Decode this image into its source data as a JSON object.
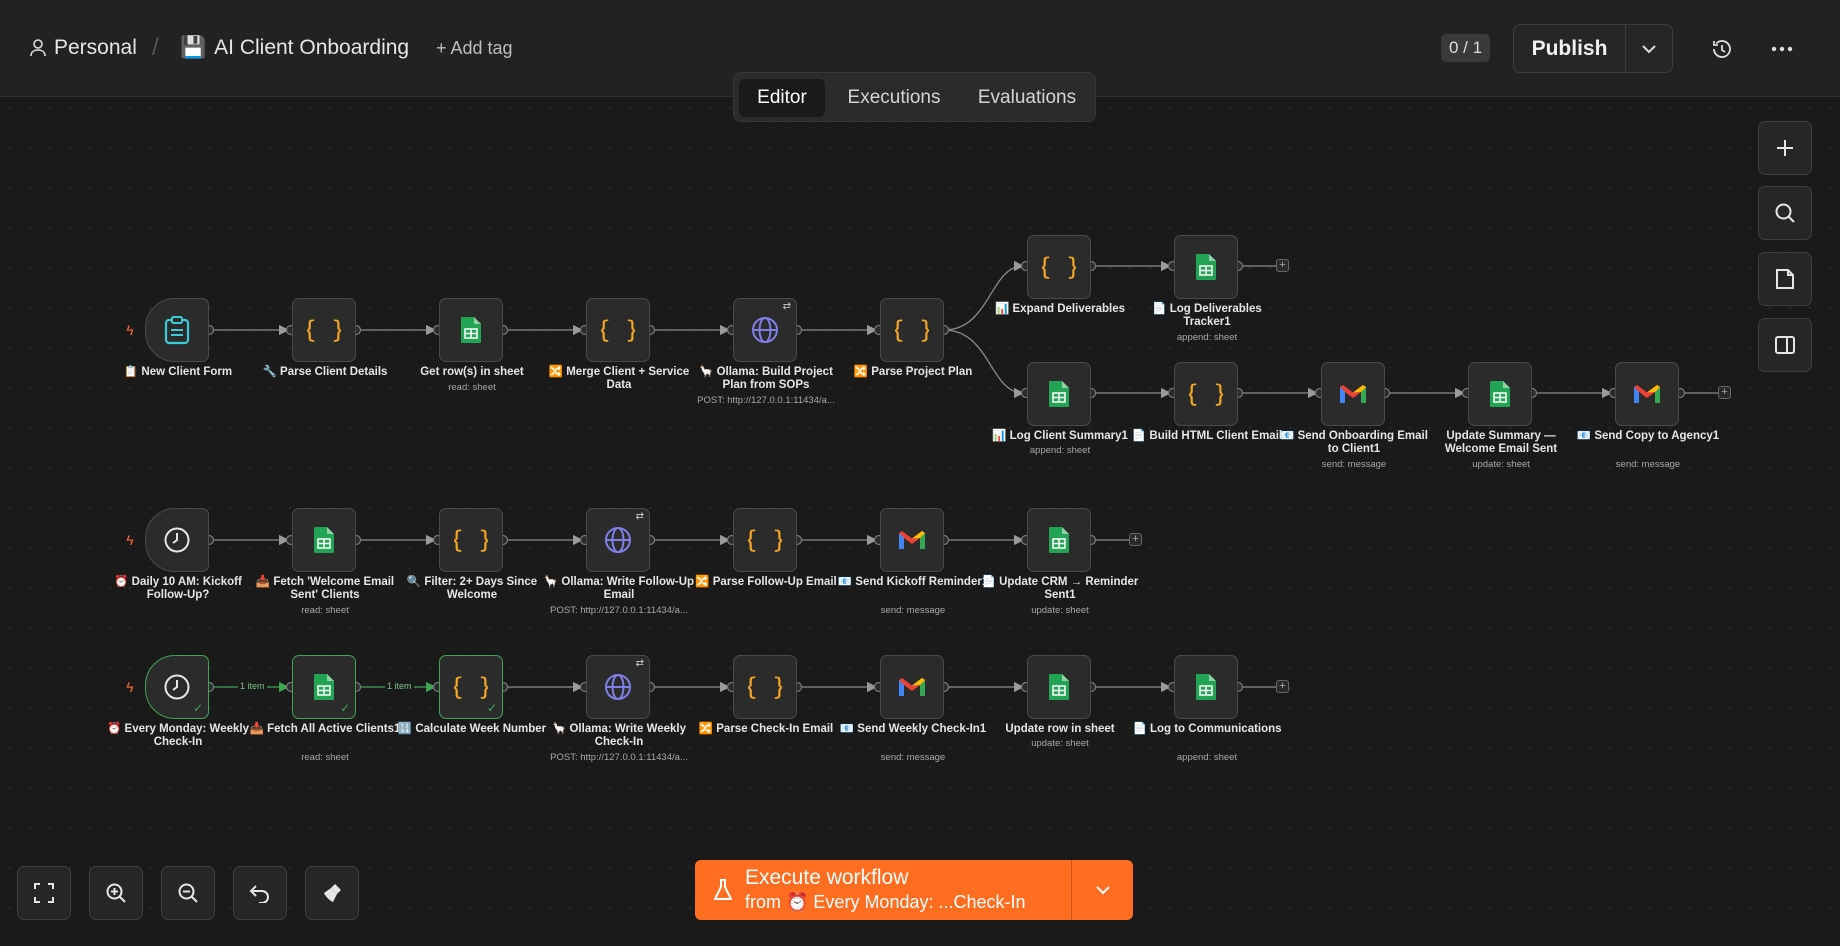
{
  "header": {
    "project": "Personal",
    "workflow_icon": "💾",
    "workflow_name": "AI Client Onboarding",
    "add_tag": "+ Add tag",
    "counter": "0 / 1",
    "publish": "Publish"
  },
  "tabs": [
    "Editor",
    "Executions",
    "Evaluations"
  ],
  "active_tab": "Editor",
  "nodes": {
    "n1": {
      "label": "📋 New Client Form",
      "sub": ""
    },
    "n2": {
      "label": "🔧 Parse Client Details",
      "sub": ""
    },
    "n3": {
      "label": "Get row(s) in sheet",
      "sub": "read: sheet"
    },
    "n4": {
      "label": "🔀 Merge Client + Service Data",
      "sub": ""
    },
    "n5": {
      "label": "🦙 Ollama: Build Project Plan from SOPs",
      "sub": "POST: http://127.0.0.1:11434/a..."
    },
    "n6": {
      "label": "🔀 Parse Project Plan",
      "sub": ""
    },
    "n7": {
      "label": "📊 Expand Deliverables",
      "sub": ""
    },
    "n8": {
      "label": "📄 Log Deliverables Tracker1",
      "sub": "append: sheet"
    },
    "n9": {
      "label": "📊 Log Client Summary1",
      "sub": "append: sheet"
    },
    "n10": {
      "label": "📄 Build HTML Client Email",
      "sub": ""
    },
    "n11": {
      "label": "📧 Send Onboarding Email to Client1",
      "sub": "send: message"
    },
    "n12": {
      "label": "Update Summary — Welcome Email Sent",
      "sub": "update: sheet"
    },
    "n13": {
      "label": "📧 Send Copy to Agency1",
      "sub": "send: message"
    },
    "m1": {
      "label": "⏰ Daily 10 AM: Kickoff Follow-Up?",
      "sub": ""
    },
    "m2": {
      "label": "📥 Fetch 'Welcome Email Sent' Clients",
      "sub": "read: sheet"
    },
    "m3": {
      "label": "🔍 Filter: 2+ Days Since Welcome",
      "sub": ""
    },
    "m4": {
      "label": "🦙 Ollama: Write Follow-Up Email",
      "sub": "POST: http://127.0.0.1:11434/a..."
    },
    "m5": {
      "label": "🔀 Parse Follow-Up Email",
      "sub": ""
    },
    "m6": {
      "label": "📧 Send Kickoff Reminder1",
      "sub": "send: message"
    },
    "m7": {
      "label": "📄 Update CRM → Reminder Sent1",
      "sub": "update: sheet"
    },
    "w1": {
      "label": "⏰ Every Monday: Weekly Check-In",
      "sub": ""
    },
    "w2": {
      "label": "📥 Fetch All Active Clients1",
      "sub": "read: sheet"
    },
    "w3": {
      "label": "🔢 Calculate Week Number",
      "sub": ""
    },
    "w4": {
      "label": "🦙 Ollama: Write Weekly Check-In",
      "sub": "POST: http://127.0.0.1:11434/a..."
    },
    "w5": {
      "label": "🔀 Parse Check-In Email",
      "sub": ""
    },
    "w6": {
      "label": "📧 Send Weekly Check-In1",
      "sub": "send: message"
    },
    "w7": {
      "label": "Update row in sheet",
      "sub": "update: sheet"
    },
    "w8": {
      "label": "📄 Log to Communications",
      "sub": "append: sheet"
    }
  },
  "edge_labels": {
    "e1": "1 item",
    "e2": "1 item"
  },
  "execute": {
    "title": "Execute workflow",
    "from": "from",
    "trigger": "⏰ Every Monday: ...Check-In"
  },
  "colors": {
    "accent": "#ff6d20",
    "success": "#3ea553",
    "sheets": "#23a455",
    "code": "#f5a623",
    "http": "#7f7fe8",
    "form": "#3ccbd8"
  }
}
